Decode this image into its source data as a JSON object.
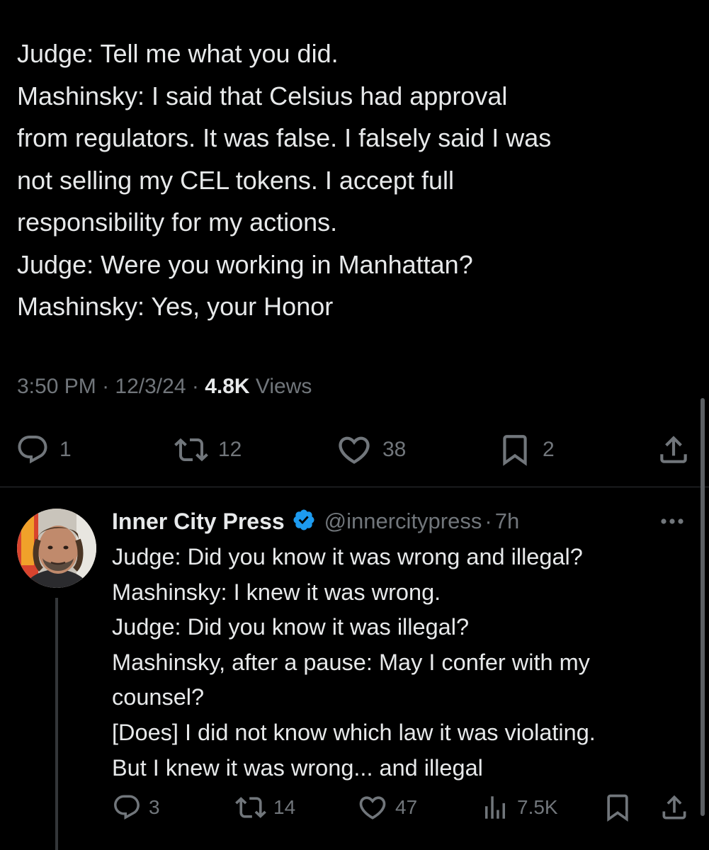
{
  "main_tweet": {
    "text_lines": [
      "Judge: Tell me what you did.",
      "Mashinsky: I said that Celsius had approval",
      "from regulators. It was false. I falsely said I was",
      "not selling my CEL tokens. I accept full",
      "responsibility for my actions.",
      "Judge: Were you working in Manhattan?",
      "Mashinsky: Yes, your Honor"
    ],
    "time": "3:50 PM",
    "date": "12/3/24",
    "separator": "·",
    "views_count": "4.8K",
    "views_label": "Views",
    "actions": {
      "replies": "1",
      "reposts": "12",
      "likes": "38",
      "bookmarks": "2"
    }
  },
  "reply_tweet": {
    "display_name": "Inner City Press",
    "handle": "@innercitypress",
    "separator": "·",
    "time_ago": "7h",
    "text_lines": [
      "Judge: Did you know it was wrong and illegal?",
      "Mashinsky: I knew it was wrong.",
      "Judge: Did you know it was illegal?",
      "Mashinsky, after a pause: May I confer with my",
      "counsel?",
      "[Does] I did not know which law it was violating.",
      "But I knew it was wrong... and illegal"
    ],
    "actions": {
      "replies": "3",
      "reposts": "14",
      "likes": "47",
      "views": "7.5K"
    }
  },
  "colors": {
    "background": "#000000",
    "text_primary": "#e7e9ea",
    "text_secondary": "#71767b",
    "divider": "#2f3336",
    "verified": "#1d9bf0"
  },
  "icons": {
    "reply": "speech-bubble-icon",
    "repost": "repost-arrows-icon",
    "like": "heart-icon",
    "bookmark": "bookmark-icon",
    "share": "share-upload-icon",
    "views": "bar-chart-icon",
    "verified": "verified-badge-icon",
    "more": "more-dots-icon"
  }
}
